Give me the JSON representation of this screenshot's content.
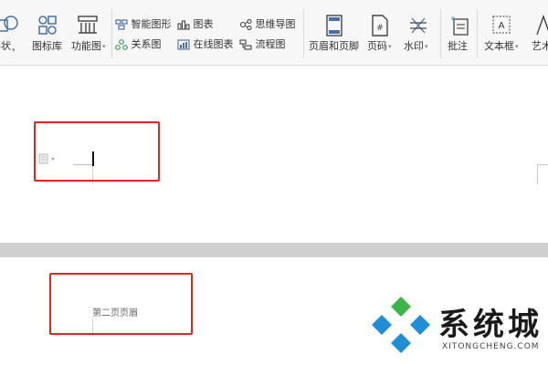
{
  "ribbon": {
    "groups": {
      "shape": {
        "label": "形状"
      },
      "icon_library": {
        "label": "图标库"
      },
      "function_chart": {
        "label": "功能图"
      },
      "smart_shape": {
        "label": "智能图形"
      },
      "relation_chart": {
        "label": "关系图"
      },
      "chart": {
        "label": "图表"
      },
      "online_chart": {
        "label": "在线图表"
      },
      "mind_map": {
        "label": "思维导图"
      },
      "flowchart": {
        "label": "流程图"
      },
      "header_footer": {
        "label": "页眉和页脚"
      },
      "page_number": {
        "label": "页码"
      },
      "watermark": {
        "label": "水印"
      },
      "comment": {
        "label": "批注"
      },
      "text_box": {
        "label": "文本框"
      },
      "art_text": {
        "label": "艺术字"
      }
    }
  },
  "document": {
    "page2_header": {
      "text": "第二页页眉"
    }
  },
  "watermark": {
    "title": "系统城",
    "subtitle": "XITONGCHENG.COM"
  },
  "colors": {
    "highlight": "#e2261c",
    "logo_blue": "#1e8fd6",
    "logo_green": "#3cb44a"
  }
}
